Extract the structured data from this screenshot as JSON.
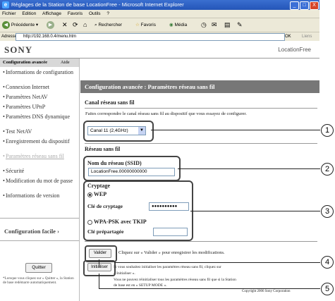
{
  "window": {
    "title": "Réglages de la Station de base LocationFree - Microsoft Internet Explorer",
    "min": "_",
    "max": "□",
    "close": "X"
  },
  "menu": [
    "Fichier",
    "Edition",
    "Affichage",
    "Favoris",
    "Outils",
    "?"
  ],
  "toolbar": {
    "back": "Précédente",
    "search": "Rechercher",
    "favorites": "Favoris",
    "media": "Média"
  },
  "address": {
    "label": "Adresse",
    "url": "http://192.168.0.4/menu.htm",
    "go": "OK",
    "links": "Liens"
  },
  "header": {
    "brand": "SONY",
    "product": "LocationFree"
  },
  "sidebar": {
    "section": "Configuration avancée",
    "help": "Aide",
    "items": [
      "Informations de configuration",
      "Connexion Internet",
      "Paramètres NetAV",
      "Paramètres UPnP",
      "Paramètres DNS dynamique",
      "Test NetAV",
      "Enregistrement du dispositif",
      "Paramètres réseau sans fil",
      "Sécurité",
      "Modification du mot de passe",
      "Informations de version"
    ],
    "easy_config": "Configuration facile",
    "quit": "Quitter",
    "note": "*Lorsque vous cliquez sur « Quitter », la Station de base redémarre automatiquement."
  },
  "main": {
    "title": "Configuration avancée : Paramètres réseau sans fil",
    "channel_title": "Canal réseau sans fil",
    "channel_text": "Faites correspondre le canal réseau sans fil au dispositif que vous essayez de configurer.",
    "channel_value": "Canal 11 (2,4GHz)",
    "wireless_title": "Réseau sans fil",
    "ssid_label": "Nom du réseau (SSID)",
    "ssid_value": "LocationFree.00000000000",
    "crypt_label": "Cryptage",
    "wep": "WEP",
    "wep_key_label": "Clé de cryptage",
    "wep_key_value": "●●●●●●●●●●",
    "wpa": "WPA-PSK avec TKIP",
    "wpa_key_label": "Clé prépartagée",
    "apply": "Valider",
    "apply_text": "Cliquez sur « Valider » pour enregistrer les modifications.",
    "reset_text1": "Si vous souhaitez initialiser les paramètres réseau sans fil, cliquez sur",
    "reset_text2": "« Initialiser ».",
    "reset": "Initialiser",
    "reset_text3": "Vous ne pouvez réinitialiser tous les paramètres réseau sans fil que si la Station",
    "reset_text4": "de base est en « SETUP MODE ».",
    "copyright": "Copyright 2006 Sony Corporation"
  },
  "callouts": [
    "1",
    "2",
    "3",
    "4",
    "5"
  ]
}
